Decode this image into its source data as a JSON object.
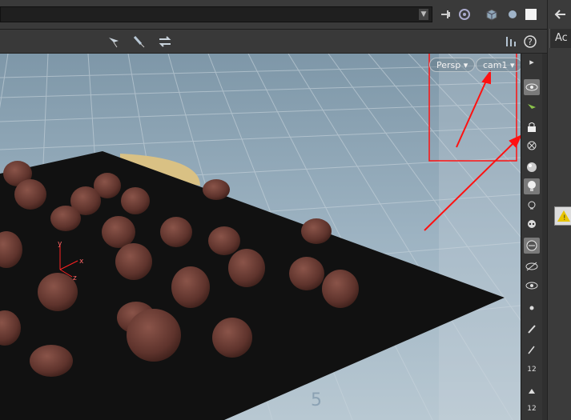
{
  "viewport": {
    "projection_button": "Persp ▾",
    "camera_button": "cam1 ▾",
    "axes": {
      "y": "y",
      "x": "x",
      "z": "z"
    },
    "grid_number": "5"
  },
  "right_panel": {
    "tab_label": "Ac"
  },
  "toolbar": {
    "help_label": "?"
  },
  "sidebar": {
    "number_a": "12",
    "number_b": "12"
  },
  "colors": {
    "ground": "#111111",
    "objects": "#6b3a33",
    "sky": "#8ea4b3",
    "annotation": "#ff0000"
  },
  "icons": [
    "pin-icon",
    "target-icon",
    "cube-icon",
    "sphere-icon",
    "square-icon",
    "back-arrow-icon",
    "select-tool-icon",
    "move-tool-icon",
    "transform-tool-icon",
    "display-options-icon",
    "help-icon",
    "eye-icon",
    "lock-icon",
    "light-icon"
  ]
}
